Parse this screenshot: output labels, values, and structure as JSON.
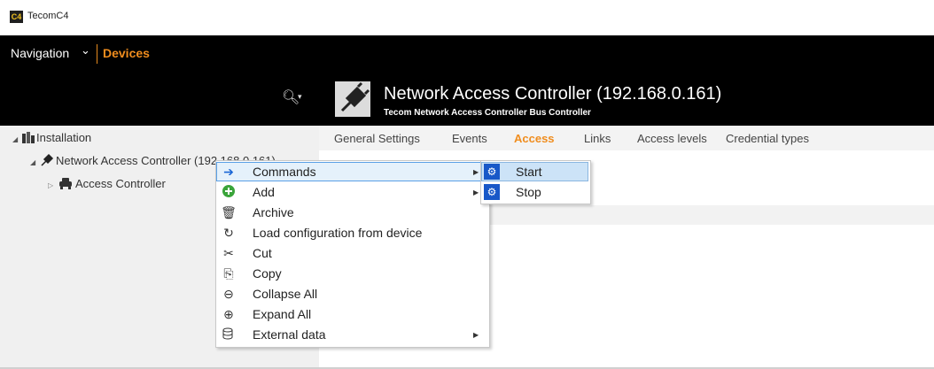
{
  "app": {
    "logo": "C4",
    "title": "TecomC4"
  },
  "nav": {
    "label": "Navigation",
    "current": "Devices"
  },
  "search": {
    "icon": "search-icon"
  },
  "tree": [
    {
      "label": "Installation",
      "icon": "building-icon"
    },
    {
      "label": "Network Access Controller (192.168.0.161)",
      "icon": "plug-icon"
    },
    {
      "label": "Access Controller",
      "icon": "car-icon"
    }
  ],
  "device": {
    "title": "Network Access Controller (192.168.0.161)",
    "subtitle": "Tecom Network Access Controller Bus Controller",
    "icon": "plug-icon"
  },
  "tabs": [
    "General Settings",
    "Events",
    "Access",
    "Links",
    "Access levels",
    "Credential types"
  ],
  "active_tab": "Access",
  "context_menu": {
    "items": [
      {
        "label": "Commands",
        "icon": "arrow-right-icon",
        "submenu": true,
        "highlighted": true
      },
      {
        "label": "Add",
        "icon": "plus-circle-icon",
        "submenu": true
      },
      {
        "label": "Archive",
        "icon": "trash-icon"
      },
      {
        "label": "Load configuration from device",
        "icon": "refresh-icon"
      },
      {
        "label": "Cut",
        "icon": "scissors-icon"
      },
      {
        "label": "Copy",
        "icon": "copy-icon"
      },
      {
        "label": "Collapse All",
        "icon": "minus-circle-icon"
      },
      {
        "label": "Expand All",
        "icon": "plus-circle-outline-icon"
      },
      {
        "label": "External data",
        "icon": "database-icon",
        "submenu": true
      }
    ]
  },
  "submenu": {
    "items": [
      {
        "label": "Start",
        "icon": "command-icon",
        "highlighted": true
      },
      {
        "label": "Stop",
        "icon": "command-icon"
      }
    ]
  },
  "colors": {
    "accent": "#f08d1e",
    "highlight": "#cce3f7",
    "header": "#000000"
  }
}
